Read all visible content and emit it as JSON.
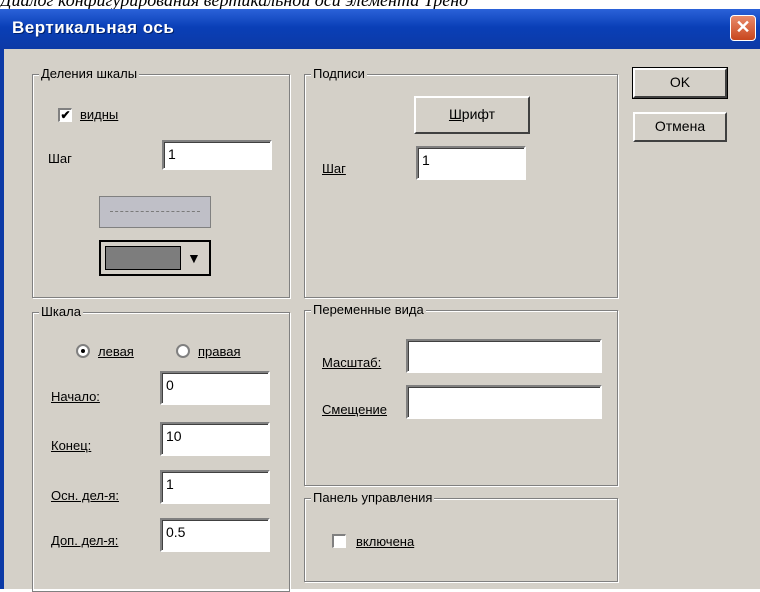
{
  "caption": "Диалог конфигурирования вертикальной оси элемента Тренд",
  "window": {
    "title": "Вертикальная ось",
    "close_glyph": "✕"
  },
  "buttons": {
    "ok": "OK",
    "cancel": "Отмена",
    "cancel_hotkey": "н",
    "font_prefix": "",
    "font_hotkey": "Ш",
    "font_rest": "рифт"
  },
  "ticks": {
    "legend": "Деления шкалы",
    "visible_label": "видны",
    "visible_checked": "✔",
    "step_label": "Шаг",
    "step_value": "1",
    "line_color": "#7d7d7d"
  },
  "labels_group": {
    "legend": "Подписи",
    "step_label": "Шаг",
    "step_value": "1"
  },
  "scale": {
    "legend": "Шкала",
    "left_label": "левая",
    "right_label": "правая",
    "start_label": "Начало:",
    "start_value": "0",
    "end_label": "Конец:",
    "end_value": "10",
    "major_label": "Осн. дел-я:",
    "major_value": "1",
    "minor_label": "Доп. дел-я:",
    "minor_value": "0.5"
  },
  "view_vars": {
    "legend": "Переменные вида",
    "scale_label": "Масштаб:",
    "scale_value": "",
    "offset_label": "Смещение",
    "offset_value": ""
  },
  "control_panel": {
    "legend": "Панель управления",
    "enabled_label": "включена"
  }
}
